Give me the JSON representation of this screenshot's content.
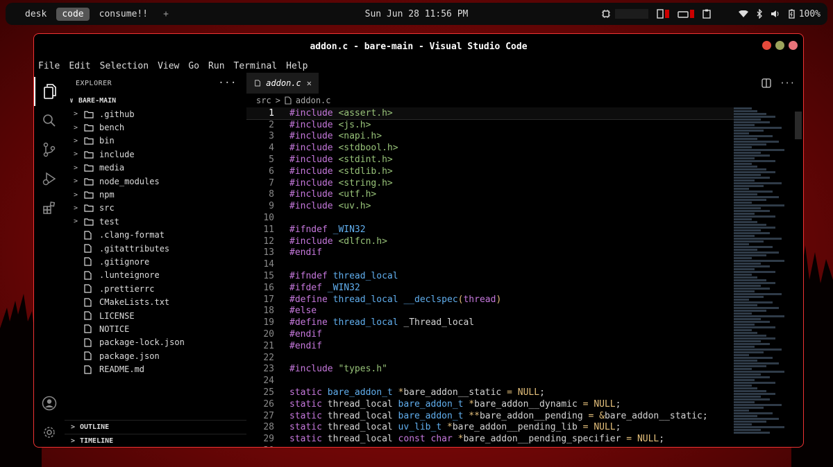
{
  "topbar": {
    "workspaces": [
      "desk",
      "code",
      "consume!!"
    ],
    "add_label": "+",
    "clock": "Sun Jun 28 11:56 PM",
    "battery": "100%"
  },
  "window": {
    "title": "addon.c - bare-main - Visual Studio Code",
    "menu": [
      "File",
      "Edit",
      "Selection",
      "View",
      "Go",
      "Run",
      "Terminal",
      "Help"
    ]
  },
  "explorer": {
    "header": "EXPLORER",
    "more": "···",
    "root": "BARE-MAIN",
    "folders": [
      ".github",
      "bench",
      "bin",
      "include",
      "media",
      "node_modules",
      "npm",
      "src",
      "test"
    ],
    "files": [
      ".clang-format",
      ".gitattributes",
      ".gitignore",
      ".lunteignore",
      ".prettierrc",
      "CMakeLists.txt",
      "LICENSE",
      "NOTICE",
      "package-lock.json",
      "package.json",
      "README.md"
    ],
    "outline": "OUTLINE",
    "timeline": "TIMELINE"
  },
  "editor": {
    "tab": "addon.c",
    "tab_close": "✕",
    "breadcrumb": [
      "src",
      "addon.c"
    ],
    "current_line": 1,
    "lines": [
      [
        [
          "kw",
          "#include "
        ],
        [
          "str",
          "<assert.h>"
        ]
      ],
      [
        [
          "kw",
          "#include "
        ],
        [
          "str",
          "<js.h>"
        ]
      ],
      [
        [
          "kw",
          "#include "
        ],
        [
          "str",
          "<napi.h>"
        ]
      ],
      [
        [
          "kw",
          "#include "
        ],
        [
          "str",
          "<stdbool.h>"
        ]
      ],
      [
        [
          "kw",
          "#include "
        ],
        [
          "str",
          "<stdint.h>"
        ]
      ],
      [
        [
          "kw",
          "#include "
        ],
        [
          "str",
          "<stdlib.h>"
        ]
      ],
      [
        [
          "kw",
          "#include "
        ],
        [
          "str",
          "<string.h>"
        ]
      ],
      [
        [
          "kw",
          "#include "
        ],
        [
          "str",
          "<utf.h>"
        ]
      ],
      [
        [
          "kw",
          "#include "
        ],
        [
          "str",
          "<uv.h>"
        ]
      ],
      [],
      [
        [
          "kw",
          "#ifndef "
        ],
        [
          "ty",
          "_WIN32"
        ]
      ],
      [
        [
          "kw",
          "#include "
        ],
        [
          "str",
          "<dlfcn.h>"
        ]
      ],
      [
        [
          "kw",
          "#endif"
        ]
      ],
      [],
      [
        [
          "kw",
          "#ifndef "
        ],
        [
          "ty",
          "thread_local"
        ]
      ],
      [
        [
          "kw",
          "#ifdef "
        ],
        [
          "ty",
          "_WIN32"
        ]
      ],
      [
        [
          "kw",
          "#define "
        ],
        [
          "ty",
          "thread_local "
        ],
        [
          "ty",
          "__declspec"
        ],
        [
          "nm",
          "("
        ],
        [
          "kw",
          "thread"
        ],
        [
          "nm",
          ")"
        ]
      ],
      [
        [
          "kw",
          "#else"
        ]
      ],
      [
        [
          "kw",
          "#define "
        ],
        [
          "ty",
          "thread_local "
        ],
        [
          "pl",
          "_Thread_local"
        ]
      ],
      [
        [
          "kw",
          "#endif"
        ]
      ],
      [
        [
          "kw",
          "#endif"
        ]
      ],
      [],
      [
        [
          "kw",
          "#include "
        ],
        [
          "str",
          "\"types.h\""
        ]
      ],
      [],
      [
        [
          "kw",
          "static "
        ],
        [
          "ty",
          "bare_addon_t "
        ],
        [
          "nm",
          "*"
        ],
        [
          "pl",
          "bare_addon__static "
        ],
        [
          "nm",
          "= "
        ],
        [
          "nm",
          "NULL"
        ],
        [
          "pl",
          ";"
        ]
      ],
      [
        [
          "kw",
          "static "
        ],
        [
          "pl",
          "thread_local "
        ],
        [
          "ty",
          "bare_addon_t "
        ],
        [
          "nm",
          "*"
        ],
        [
          "pl",
          "bare_addon__dynamic "
        ],
        [
          "nm",
          "= "
        ],
        [
          "nm",
          "NULL"
        ],
        [
          "pl",
          ";"
        ]
      ],
      [
        [
          "kw",
          "static "
        ],
        [
          "pl",
          "thread_local "
        ],
        [
          "ty",
          "bare_addon_t "
        ],
        [
          "nm",
          "**"
        ],
        [
          "pl",
          "bare_addon__pending "
        ],
        [
          "nm",
          "= &"
        ],
        [
          "pl",
          "bare_addon__static;"
        ]
      ],
      [
        [
          "kw",
          "static "
        ],
        [
          "pl",
          "thread_local "
        ],
        [
          "ty",
          "uv_lib_t "
        ],
        [
          "nm",
          "*"
        ],
        [
          "pl",
          "bare_addon__pending_lib "
        ],
        [
          "nm",
          "= "
        ],
        [
          "nm",
          "NULL"
        ],
        [
          "pl",
          ";"
        ]
      ],
      [
        [
          "kw",
          "static "
        ],
        [
          "pl",
          "thread_local "
        ],
        [
          "kw",
          "const char "
        ],
        [
          "nm",
          "*"
        ],
        [
          "pl",
          "bare_addon__pending_specifier "
        ],
        [
          "nm",
          "= "
        ],
        [
          "nm",
          "NULL"
        ],
        [
          "pl",
          ";"
        ]
      ],
      []
    ]
  },
  "colors": {
    "accent_border": "#e33",
    "keyword": "#c678dd",
    "string": "#98c379",
    "type": "#61afef",
    "number": "#e5c07b"
  }
}
